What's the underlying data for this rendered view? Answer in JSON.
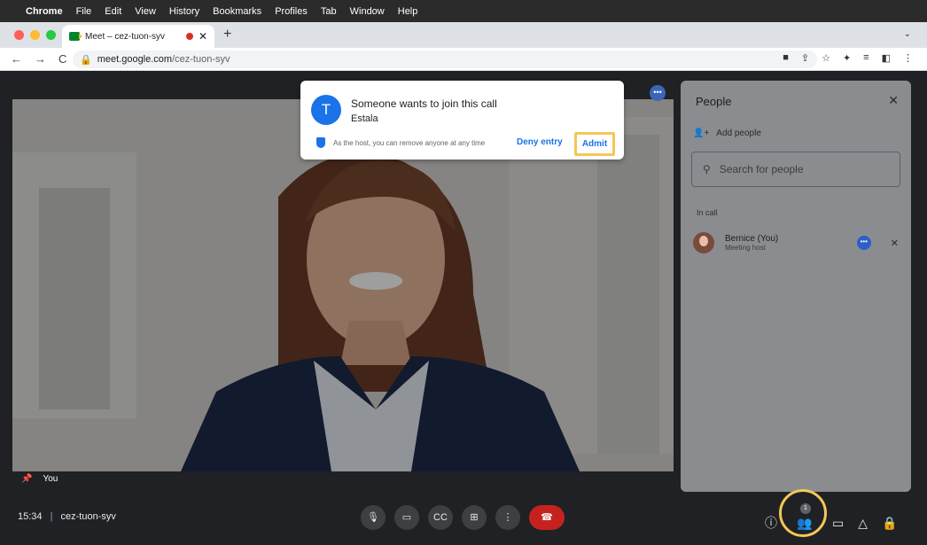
{
  "menubar": {
    "apple": "",
    "items": [
      "Chrome",
      "File",
      "Edit",
      "View",
      "History",
      "Bookmarks",
      "Profiles",
      "Tab",
      "Window",
      "Help"
    ]
  },
  "browser": {
    "tab_title": "Meet – cez-tuon-syv",
    "tab_close": "✕",
    "new_tab": "+",
    "tab_menu": "⌄",
    "nav_back": "←",
    "nav_forward": "→",
    "nav_reload": "C",
    "url_host": "meet.google.com",
    "url_path": "/cez-tuon-syv"
  },
  "join_request": {
    "avatar_letter": "T",
    "title": "Someone wants to join this call",
    "name": "Estala",
    "hint": "As the host, you can remove anyone at any time",
    "deny_label": "Deny entry",
    "admit_label": "Admit"
  },
  "video": {
    "self_label": "You"
  },
  "people_panel": {
    "title": "People",
    "close": "✕",
    "add_people": "Add people",
    "search_placeholder": "Search for people",
    "section_label": "In call",
    "participants": [
      {
        "name": "Bernice (You)",
        "role": "Meeting host"
      }
    ]
  },
  "bottom_bar": {
    "time": "15:34",
    "separator": "|",
    "meeting_code": "cez-tuon-syv",
    "people_badge": "1"
  },
  "colors": {
    "accent": "#1a73e8",
    "highlight": "#f3c857",
    "hangup": "#c5221f"
  }
}
